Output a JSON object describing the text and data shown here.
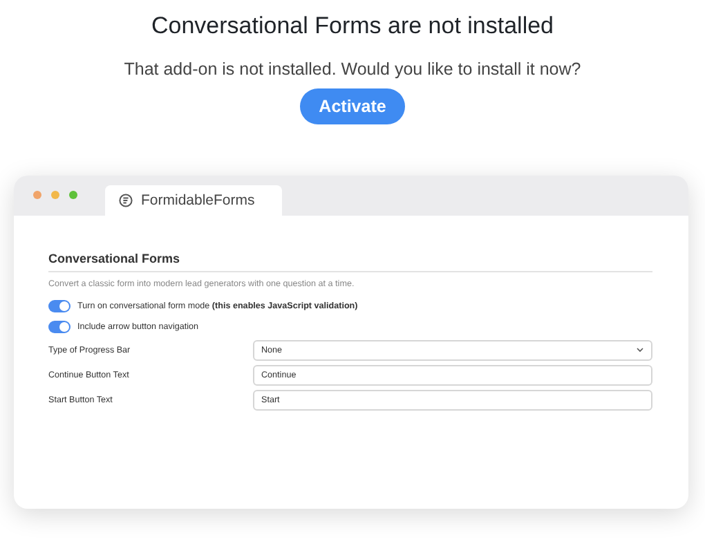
{
  "title": "Conversational Forms are not installed",
  "message": "That add-on is not installed. Would you like to install it now?",
  "button": "Activate",
  "window": {
    "tab": {
      "label": "FormidableForms",
      "selected": true
    },
    "section": {
      "title": "Conversational Forms",
      "description": "Convert a classic form into modern lead generators with one question at a time.",
      "settings": [
        {
          "kind": "toggle",
          "label": "Turn on conversational form mode **(this enables JavaScript validation)**",
          "on": true
        },
        {
          "kind": "toggle",
          "label": "Include arrow button navigation",
          "on": true
        },
        {
          "kind": "select",
          "label": "Type of Progress Bar",
          "value": "None"
        },
        {
          "kind": "text",
          "label": "Continue Button Text",
          "value": "Continue"
        },
        {
          "kind": "text",
          "label": "Start Button Text",
          "value": "Start"
        }
      ]
    }
  }
}
